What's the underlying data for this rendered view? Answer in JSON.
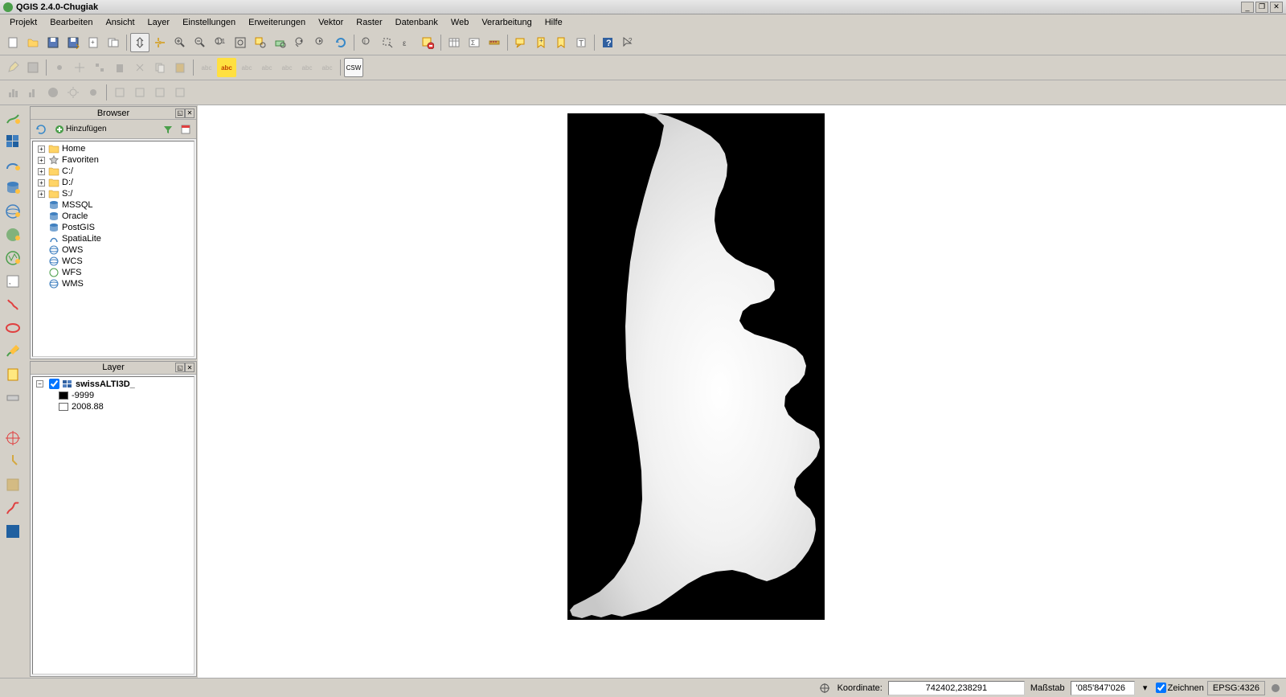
{
  "title": "QGIS 2.4.0-Chugiak",
  "menu": [
    "Projekt",
    "Bearbeiten",
    "Ansicht",
    "Layer",
    "Einstellungen",
    "Erweiterungen",
    "Vektor",
    "Raster",
    "Datenbank",
    "Web",
    "Verarbeitung",
    "Hilfe"
  ],
  "browser": {
    "title": "Browser",
    "add_button": "Hinzufügen",
    "items": [
      {
        "label": "Home",
        "icon": "folder"
      },
      {
        "label": "Favoriten",
        "icon": "star"
      },
      {
        "label": "C:/",
        "icon": "folder"
      },
      {
        "label": "D:/",
        "icon": "folder"
      },
      {
        "label": "S:/",
        "icon": "folder"
      },
      {
        "label": "MSSQL",
        "icon": "db"
      },
      {
        "label": "Oracle",
        "icon": "db"
      },
      {
        "label": "PostGIS",
        "icon": "db"
      },
      {
        "label": "SpatiaLite",
        "icon": "db"
      },
      {
        "label": "OWS",
        "icon": "globe"
      },
      {
        "label": "WCS",
        "icon": "globe"
      },
      {
        "label": "WFS",
        "icon": "globe"
      },
      {
        "label": "WMS",
        "icon": "globe"
      }
    ]
  },
  "layers": {
    "title": "Layer",
    "layer_name": "swissALTI3D_",
    "band_min": "-9999",
    "band_max": "2008.88"
  },
  "statusbar": {
    "coord_label": "Koordinate:",
    "coord_value": "742402,238291",
    "scale_label": "Maßstab",
    "scale_value": "'085'847'026",
    "render_label": "Zeichnen",
    "crs": "EPSG:4326"
  },
  "toolbar_row2_labels": [
    "abc",
    "abc",
    "abc",
    "abc",
    "abc",
    "abc",
    "abc"
  ],
  "csw_label": "CSW"
}
